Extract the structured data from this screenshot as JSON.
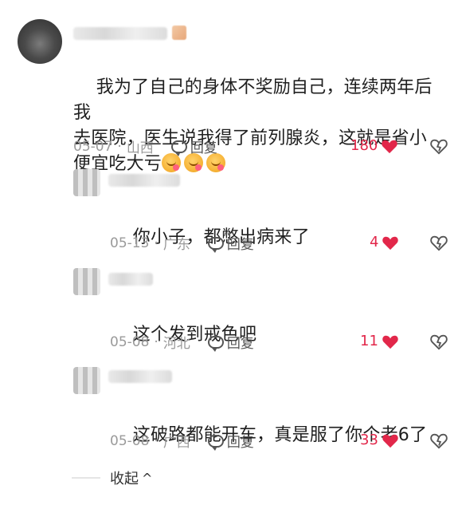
{
  "comments": [
    {
      "text": "我为了自己的身体不奖励自己，连续两年后我\n去医院，医生说我得了前列腺炎，这就是省小\n便宜吃大亏",
      "date": "05-07",
      "location": "山西",
      "reply_label": "回复",
      "likes": "180"
    },
    {
      "text": "你小子，都憋出病来了",
      "date": "05-13",
      "location": "广东",
      "reply_label": "回复",
      "likes": "4"
    },
    {
      "text": "这个发到戒色吧",
      "date": "05-08",
      "location": "河北",
      "reply_label": "回复",
      "likes": "11"
    },
    {
      "text": "这破路都能开车，真是服了你个老6了",
      "date": "05-08",
      "location": "广西",
      "reply_label": "回复",
      "likes": "33"
    }
  ],
  "collapse_label": "收起",
  "colors": {
    "like": "#e2274a",
    "meta": "#9a9a9a"
  },
  "icons": [
    "reply-icon",
    "heart-icon",
    "dislike-heart-icon",
    "chevron-up-icon",
    "emoji-icon"
  ]
}
